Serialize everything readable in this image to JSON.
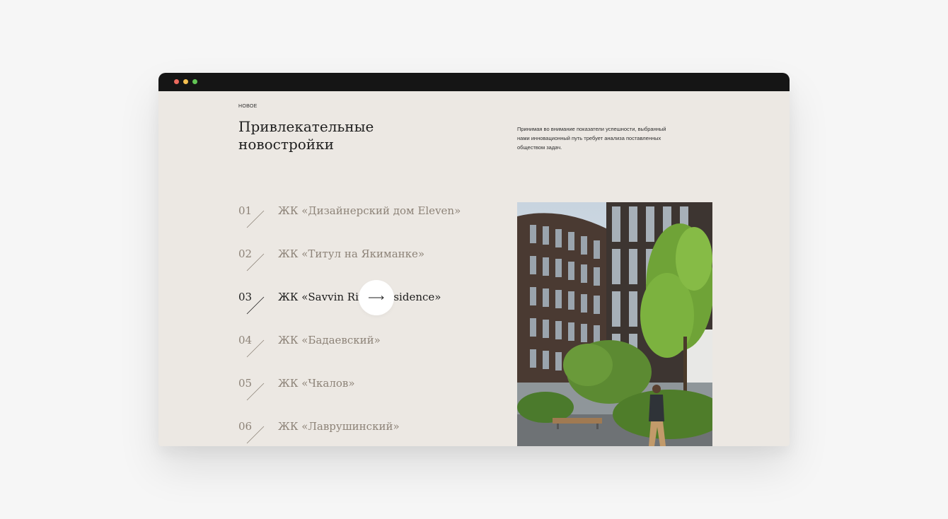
{
  "window": {
    "controls": [
      "close",
      "minimize",
      "maximize"
    ]
  },
  "section": {
    "eyebrow": "НОВОЕ",
    "title_line1": "Привлекательные",
    "title_line2": "новостройки",
    "description": "Принимая во внимание показатели успешности, выбранный нами инновационный путь требует анализа поставленных обществом задач."
  },
  "projects": [
    {
      "num": "01",
      "name": "ЖК «Дизайнерский дом Eleven»"
    },
    {
      "num": "02",
      "name": "ЖК «Титул на Якиманке»"
    },
    {
      "num": "03",
      "name": "ЖК «Savvin River Residence»",
      "active": true
    },
    {
      "num": "04",
      "name": "ЖК «Бадаевский»"
    },
    {
      "num": "05",
      "name": "ЖК «Чкалов»"
    },
    {
      "num": "06",
      "name": "ЖК «Лаврушинский»"
    }
  ],
  "cursor": {
    "icon": "arrow-right-icon"
  },
  "colors": {
    "page_bg": "#ece8e3",
    "muted_text": "#8d8378",
    "active_text": "#1c1c1c",
    "titlebar": "#151515"
  }
}
